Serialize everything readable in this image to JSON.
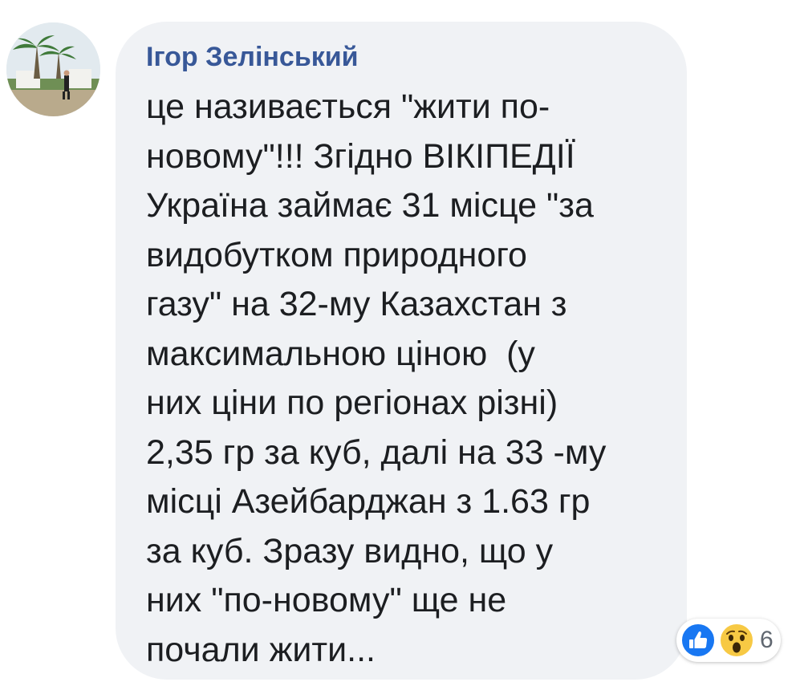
{
  "comment": {
    "author": "Ігор Зелінський",
    "text_lines": [
      "це називається \"жити по-",
      "новому\"!!! Згідно ВІКІПЕДІЇ",
      "Україна займає 31 місце \"за",
      "видобутком природного",
      "газу\" на 32-му Казахстан з",
      "максимальною ціною  (у",
      "них ціни по регіонах різні)",
      "2,35 гр за куб, далі на 33 -му",
      "місці Азейбарджан з 1.63 гр",
      "за куб. Зразу видно, що у",
      "них \"по-новому\" ще не",
      "почали жити..."
    ]
  },
  "reactions": {
    "icons": [
      "like-icon",
      "wow-icon"
    ],
    "count": "6"
  },
  "colors": {
    "author": "#385898",
    "bubble": "#f0f2f5",
    "text": "#1c1e21",
    "like": "#1877f2",
    "wow": "#f7c944"
  }
}
